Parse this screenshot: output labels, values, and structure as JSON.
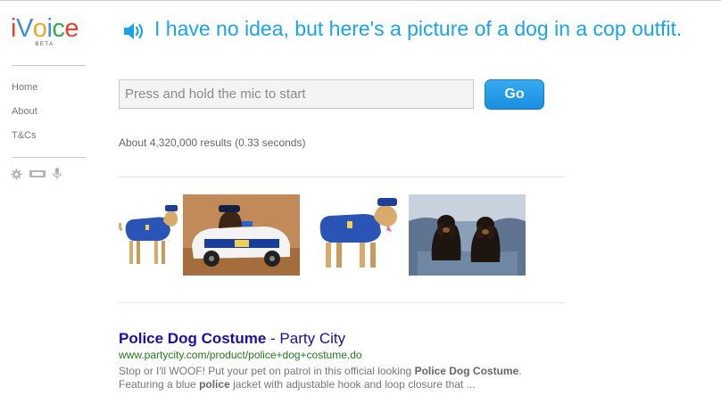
{
  "app": {
    "logo_letters": [
      {
        "char": "i",
        "color": "#e8402f"
      },
      {
        "char": "V",
        "color": "#3c8de0"
      },
      {
        "char": "o",
        "color": "#f0a71f"
      },
      {
        "char": "i",
        "color": "#3c8de0"
      },
      {
        "char": "c",
        "color": "#30a854"
      },
      {
        "char": "e",
        "color": "#e8402f"
      }
    ],
    "logo_badge": "BETA"
  },
  "sidebar": {
    "nav": [
      {
        "label": "Home"
      },
      {
        "label": "About"
      },
      {
        "label": "T&Cs"
      }
    ],
    "tool_icons": [
      "gear-icon",
      "keyboard-icon",
      "microphone-icon"
    ]
  },
  "header": {
    "answer_text": "I have no idea, but here's a picture of a dog in a cop outfit.",
    "answer_color": "#1aa3e8"
  },
  "search": {
    "placeholder": "Press and hold the mic to start",
    "value": "",
    "button_label": "Go"
  },
  "results": {
    "stats": "About 4,320,000 results (0.33 seconds)",
    "images": [
      {
        "subject": "dog in blue police costume"
      },
      {
        "subject": "dog in toy police car"
      },
      {
        "subject": "dog in blue police costume"
      },
      {
        "subject": "two dachshunds on a sofa"
      }
    ],
    "items": [
      {
        "title": "Police Dog Costume",
        "separator": " - ",
        "site": "Party City",
        "url": "www.partycity.com/product/police+dog+costume.do",
        "snippet_parts": [
          {
            "text": "Stop or I'll WOOF! Put your pet on patrol in this official looking ",
            "bold": false
          },
          {
            "text": "Police Dog Costume",
            "bold": true
          },
          {
            "text": ". Featuring a blue ",
            "bold": false
          },
          {
            "text": "police",
            "bold": true
          },
          {
            "text": " jacket with adjustable hook and loop closure that ...",
            "bold": false
          }
        ]
      }
    ]
  },
  "colors": {
    "link": "#1a0dab",
    "url": "#1e7a1e",
    "button": "#1a8fe0"
  }
}
